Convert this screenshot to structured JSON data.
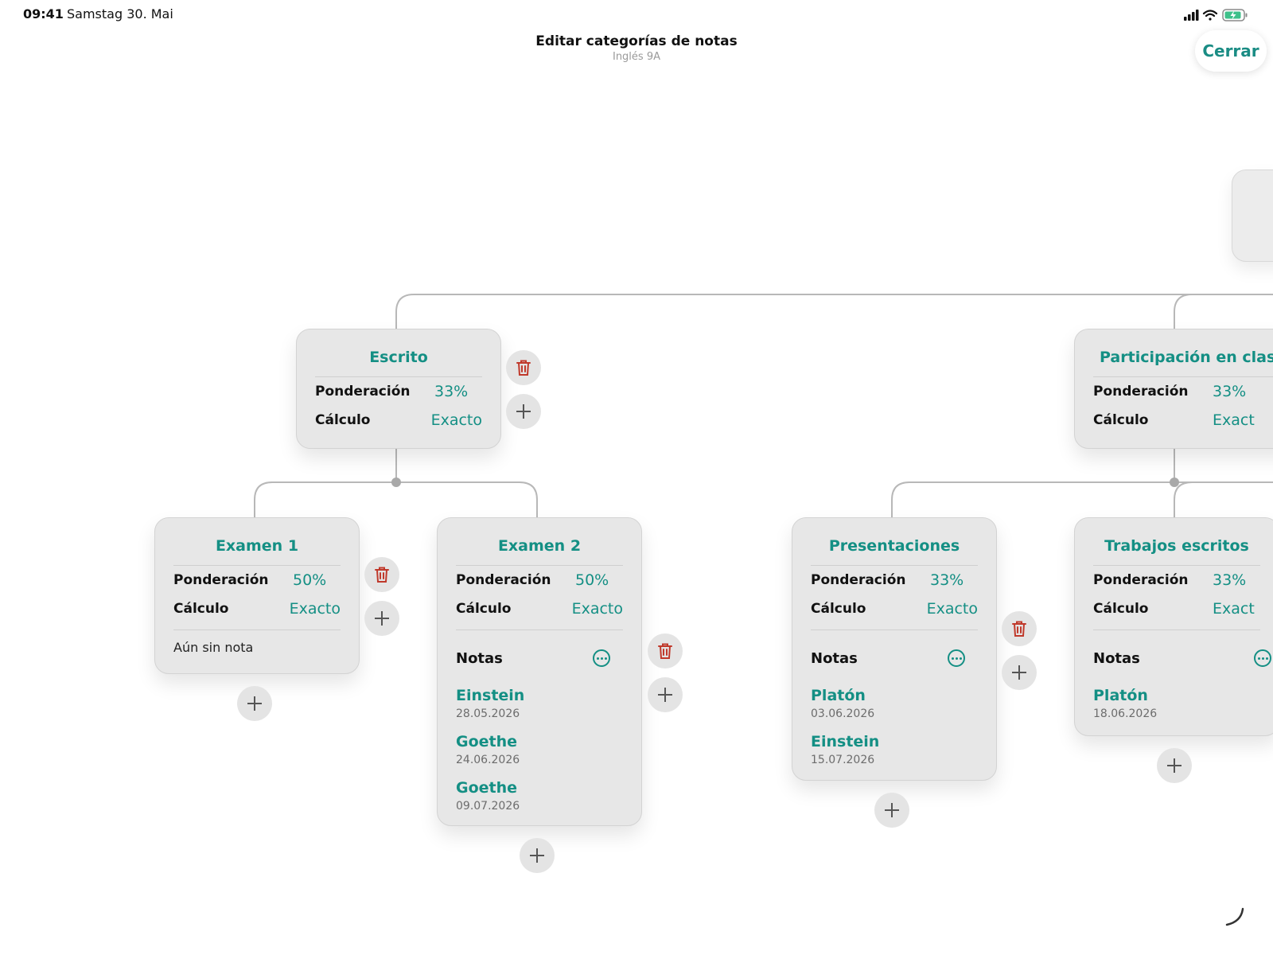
{
  "status_bar": {
    "time": "09:41",
    "date": "Samstag 30. Mai"
  },
  "header": {
    "title": "Editar categorías de notas",
    "subtitle": "Inglés 9A",
    "close_label": "Cerrar"
  },
  "labels": {
    "weight": "Ponderación",
    "calculation": "Cálculo",
    "notes": "Notas"
  },
  "colors": {
    "accent": "#148f84",
    "danger": "#c0392b",
    "card_bg": "#e7e7e7"
  },
  "icons": [
    "signal-icon",
    "wifi-icon",
    "battery-icon",
    "trash-icon",
    "plus-icon",
    "more-icon"
  ],
  "categories": [
    {
      "title": "Escrito",
      "weight": "33%",
      "calculation": "Exacto"
    },
    {
      "title": "Participación en clase",
      "weight": "33%",
      "calculation": "Exact"
    },
    {
      "title": "Examen 1",
      "weight": "50%",
      "calculation": "Exacto",
      "empty": "Aún sin nota"
    },
    {
      "title": "Examen 2",
      "weight": "50%",
      "calculation": "Exacto",
      "notes": [
        {
          "name": "Einstein",
          "date": "28.05.2026"
        },
        {
          "name": "Goethe",
          "date": "24.06.2026"
        },
        {
          "name": "Goethe",
          "date": "09.07.2026"
        }
      ]
    },
    {
      "title": "Presentaciones",
      "weight": "33%",
      "calculation": "Exacto",
      "notes": [
        {
          "name": "Platón",
          "date": "03.06.2026"
        },
        {
          "name": "Einstein",
          "date": "15.07.2026"
        }
      ]
    },
    {
      "title": "Trabajos escritos",
      "weight": "33%",
      "calculation": "Exact",
      "notes": [
        {
          "name": "Platón",
          "date": "18.06.2026"
        }
      ]
    }
  ]
}
